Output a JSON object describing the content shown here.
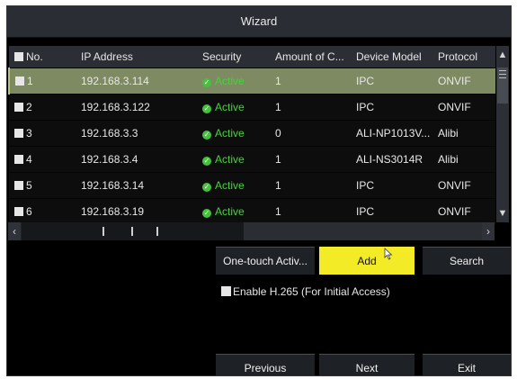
{
  "window": {
    "title": "Wizard"
  },
  "table": {
    "columns": [
      "No.",
      "IP Address",
      "Security",
      "Amount of C...",
      "Device Model",
      "Protocol"
    ],
    "rows": [
      {
        "no": "1",
        "ip": "192.168.3.114",
        "security": "Active",
        "amount": "1",
        "model": "IPC",
        "protocol": "ONVIF"
      },
      {
        "no": "2",
        "ip": "192.168.3.122",
        "security": "Active",
        "amount": "1",
        "model": "IPC",
        "protocol": "ONVIF"
      },
      {
        "no": "3",
        "ip": "192.168.3.3",
        "security": "Active",
        "amount": "0",
        "model": "ALI-NP1013V...",
        "protocol": "Alibi"
      },
      {
        "no": "4",
        "ip": "192.168.3.4",
        "security": "Active",
        "amount": "1",
        "model": "ALI-NS3014R",
        "protocol": "Alibi"
      },
      {
        "no": "5",
        "ip": "192.168.3.14",
        "security": "Active",
        "amount": "1",
        "model": "IPC",
        "protocol": "ONVIF"
      },
      {
        "no": "6",
        "ip": "192.168.3.19",
        "security": "Active",
        "amount": "1",
        "model": "IPC",
        "protocol": "ONVIF"
      }
    ],
    "selected_row": 1
  },
  "actions": {
    "one_touch": "One-touch Activ...",
    "add": "Add",
    "search": "Search"
  },
  "option": {
    "enable_h265": "Enable H.265 (For Initial Access)"
  },
  "footer": {
    "previous": "Previous",
    "next": "Next",
    "exit": "Exit"
  },
  "icons": {
    "status": "check-circle-icon",
    "scroll_up": "chevron-up-icon",
    "scroll_down": "chevron-down-icon",
    "scroll_left": "chevron-left-icon",
    "scroll_right": "chevron-right-icon",
    "pointer": "mouse-pointer-icon"
  },
  "colors": {
    "title_bg": "#2a2d33",
    "selected_row": "#7e8a62",
    "active_text": "#48d13e",
    "add_button": "#f4eb27"
  }
}
